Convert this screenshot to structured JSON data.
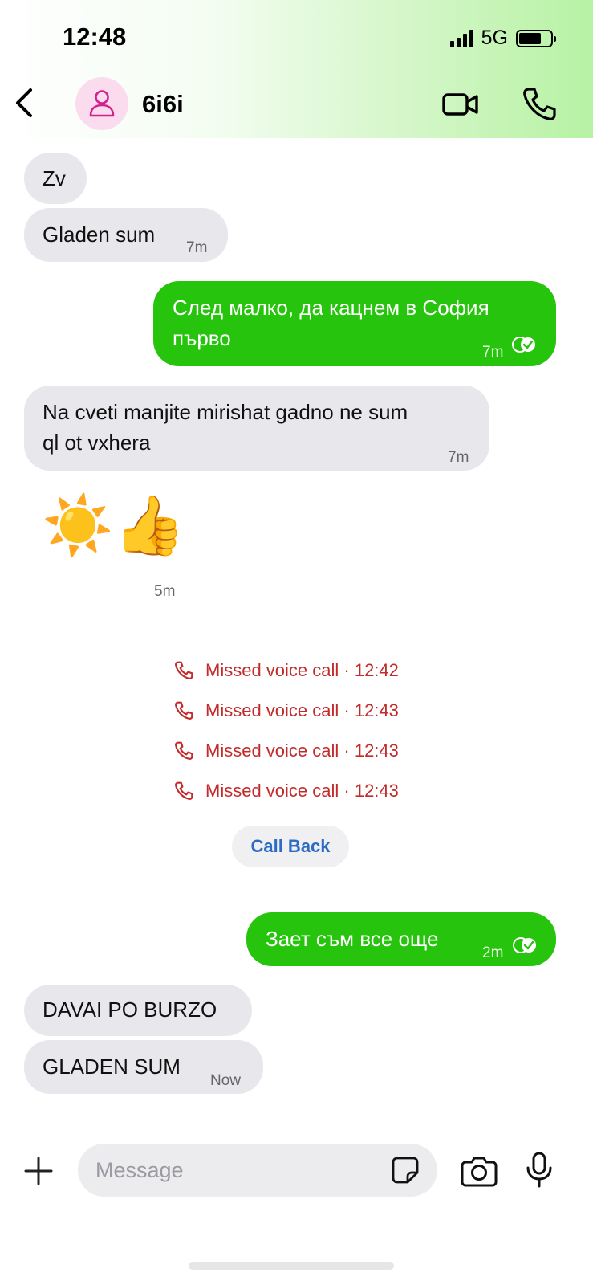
{
  "status_bar": {
    "time": "12:48",
    "network": "5G"
  },
  "header": {
    "contact_name": "6i6i"
  },
  "messages": [
    {
      "dir": "in",
      "text": "Zv"
    },
    {
      "dir": "in",
      "text": "Gladen sum",
      "time": "7m"
    },
    {
      "dir": "out",
      "line1": "След малко, да кацнем в София",
      "line2": "първо",
      "time": "7m"
    },
    {
      "dir": "in",
      "line1": "Na cveti manjite mirishat gadno ne sum",
      "line2": "ql ot vxhera",
      "time": "7m"
    },
    {
      "dir": "in",
      "emoji": "☀️👍",
      "time": "5m"
    },
    {
      "dir": "out",
      "text": "Зает съм все още",
      "time": "2m"
    },
    {
      "dir": "in",
      "text": "DAVAI PO BURZO"
    },
    {
      "dir": "in",
      "text": "GLADEN SUM",
      "time": "Now"
    }
  ],
  "missed_calls": [
    "Missed voice call · 12:42",
    "Missed voice call · 12:43",
    "Missed voice call · 12:43",
    "Missed voice call · 12:43"
  ],
  "call_back_label": "Call Back",
  "composer": {
    "placeholder": "Message",
    "value": ""
  },
  "colors": {
    "outgoing": "#26c40c",
    "incoming": "#e8e8ec",
    "missed": "#c32a2a",
    "link": "#2d6cc4",
    "avatar_bg": "#fbdcef",
    "avatar_icon": "#d2218e"
  }
}
